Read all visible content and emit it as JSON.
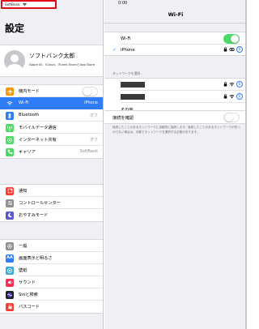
{
  "status_bar": {
    "carrier": "SoftBank",
    "time": "0:00"
  },
  "settings": {
    "title": "設定",
    "profile": {
      "name": "ソフトバンク太郎",
      "subtitle": "Apple ID、iCloud、iTunes StoreとApp Store"
    },
    "group1": [
      {
        "label": "機内モード",
        "icon": "airplane-icon",
        "color": "#ff9500",
        "toggle": false
      },
      {
        "label": "Wi-Fi",
        "icon": "wifi-icon",
        "color": "#2e7cf6",
        "value": "iPhone",
        "selected": true
      },
      {
        "label": "Bluetooth",
        "icon": "bluetooth-icon",
        "color": "#2e7cf6",
        "value": "オフ"
      },
      {
        "label": "モバイルデータ通信",
        "icon": "antenna-icon",
        "color": "#4cd964"
      },
      {
        "label": "インターネット共有",
        "icon": "hotspot-icon",
        "color": "#4cd964",
        "value": "オフ"
      },
      {
        "label": "キャリア",
        "icon": "phone-icon",
        "color": "#4cd964",
        "value": "SoftBank"
      }
    ],
    "group2": [
      {
        "label": "通知",
        "icon": "notifications-icon",
        "color": "#ff3b30"
      },
      {
        "label": "コントロールセンター",
        "icon": "control-center-icon",
        "color": "#8e8e93"
      },
      {
        "label": "おやすみモード",
        "icon": "moon-icon",
        "color": "#5856d6"
      }
    ],
    "group3": [
      {
        "label": "一般",
        "icon": "gear-icon",
        "color": "#8e8e93"
      },
      {
        "label": "画面表示と明るさ",
        "icon": "display-icon",
        "color": "#2e7cf6"
      },
      {
        "label": "壁紙",
        "icon": "wallpaper-icon",
        "color": "#34aadc"
      },
      {
        "label": "サウンド",
        "icon": "sound-icon",
        "color": "#ff2d55"
      },
      {
        "label": "Siriと検索",
        "icon": "siri-icon",
        "color": "#222222"
      },
      {
        "label": "パスコード",
        "icon": "passcode-icon",
        "color": "#ff3b30"
      }
    ]
  },
  "wifi": {
    "title": "Wi-Fi",
    "wifi_label": "Wi-Fi",
    "wifi_on": true,
    "connected_network": "iPhone",
    "choose_header": "ネットワークを選択...",
    "other_label": "その他...",
    "ask_label": "接続を確認",
    "ask_on": false,
    "footnote": "接続したことのあるネットワークに自動的に接続します。接続したことのあるネットワークが見つからない場合は、手動でネットワークを選択する必要があります。"
  },
  "colors": {
    "accent": "#2e7cf6",
    "toggle_on": "#4cd964",
    "highlight_border": "#e00b16"
  }
}
